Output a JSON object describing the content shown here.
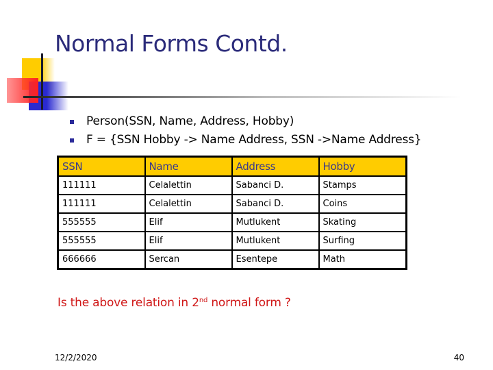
{
  "slide": {
    "title": "Normal Forms Contd.",
    "bullets": [
      "Person(SSN, Name, Address, Hobby)",
      "F = {SSN Hobby -> Name Address, SSN ->Name Address}"
    ],
    "table": {
      "headers": [
        "SSN",
        "Name",
        "Address",
        "Hobby"
      ],
      "rows": [
        [
          "111111",
          "Celalettin",
          "Sabanci D.",
          "Stamps"
        ],
        [
          "111111",
          "Celalettin",
          "Sabanci D.",
          "Coins"
        ],
        [
          "555555",
          "Elif",
          "Mutlukent",
          "Skating"
        ],
        [
          "555555",
          "Elif",
          "Mutlukent",
          "Surfing"
        ],
        [
          "666666",
          "Sercan",
          "Esentepe",
          "Math"
        ]
      ]
    },
    "question": {
      "before": "Is the above relation in 2",
      "superscript": "nd",
      "after": " normal form ?"
    },
    "footer": {
      "date": "12/2/2020",
      "page_number": "40"
    },
    "colors": {
      "title": "#2b2b7a",
      "header_fill": "#ffcc00",
      "header_text": "#3a3a8a",
      "question_text": "#d01818",
      "bullet": "#2b2b9a"
    }
  }
}
